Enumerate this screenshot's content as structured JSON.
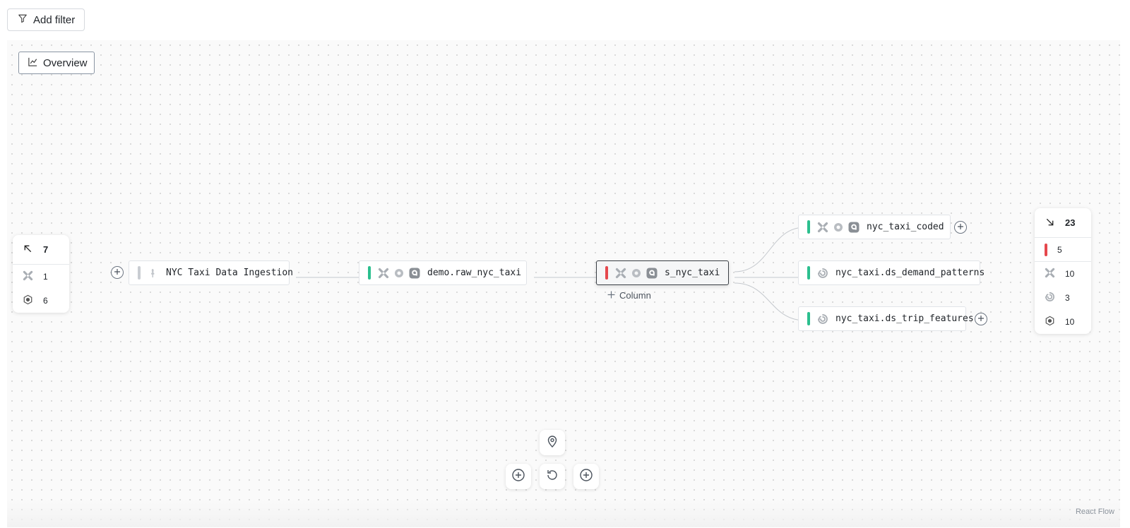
{
  "toolbar": {
    "add_filter_label": "Add filter"
  },
  "canvas": {
    "overview_label": "Overview",
    "attribution": "React Flow",
    "add_column_label": "Column"
  },
  "upstream_panel": {
    "count": "7",
    "rows": [
      {
        "icon": "tool-icon",
        "value": "1"
      },
      {
        "icon": "hexagon-icon",
        "value": "6"
      }
    ]
  },
  "downstream_panel": {
    "count": "23",
    "rows": [
      {
        "icon": "error-status-bar",
        "value": "5"
      },
      {
        "icon": "tool-icon",
        "value": "10"
      },
      {
        "icon": "swirl-icon",
        "value": "3"
      },
      {
        "icon": "hexagon-icon",
        "value": "10"
      }
    ]
  },
  "nodes": {
    "ingestion": {
      "label": "NYC Taxi Data Ingestion",
      "status": "unknown"
    },
    "raw": {
      "label": "demo.raw_nyc_taxi",
      "status": "healthy"
    },
    "selected": {
      "label": "s_nyc_taxi",
      "status": "failing"
    },
    "coded": {
      "label": "nyc_taxi_coded",
      "status": "healthy"
    },
    "demand": {
      "label": "nyc_taxi.ds_demand_patterns",
      "status": "healthy"
    },
    "trip": {
      "label": "nyc_taxi.ds_trip_features",
      "status": "healthy"
    }
  },
  "colors": {
    "healthy": "#2bbf8e",
    "failing": "#e5484d",
    "unknown": "#c9cdd2"
  }
}
